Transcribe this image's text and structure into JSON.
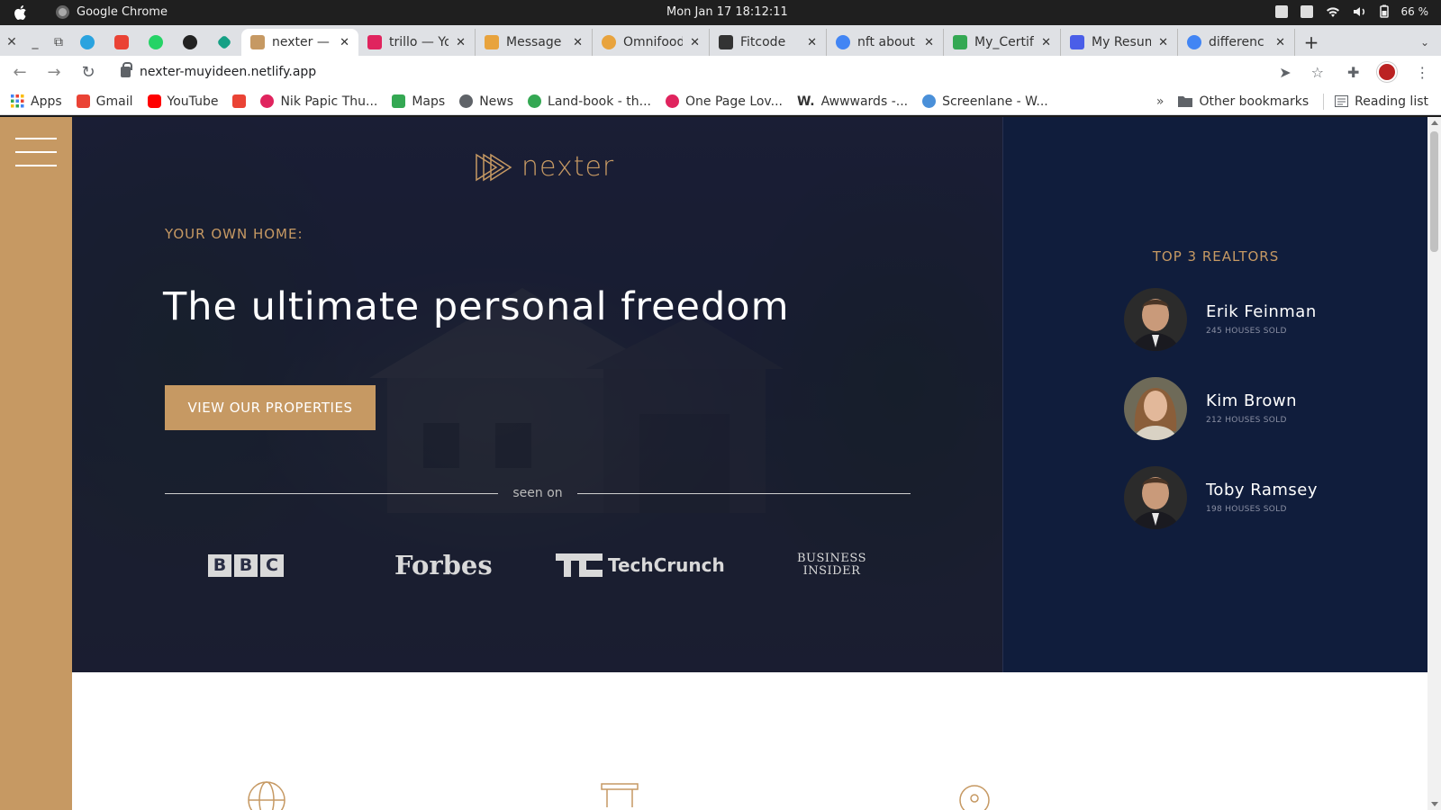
{
  "os": {
    "app_name": "Google Chrome",
    "clock": "Mon Jan 17  18:12:11",
    "battery": "66 %"
  },
  "tabs": [
    {
      "title": "nexter —",
      "active": true,
      "favicon_color": "#c69963"
    },
    {
      "title": "trillo — Yo",
      "active": false,
      "favicon_color": "#e0245e"
    },
    {
      "title": "Message",
      "active": false,
      "favicon_color": "#e8a33d"
    },
    {
      "title": "Omnifood",
      "active": false,
      "favicon_color": "#e8a33d"
    },
    {
      "title": "Fitcode",
      "active": false,
      "favicon_color": "#333333"
    },
    {
      "title": "nft about",
      "active": false,
      "favicon_color": "#4285f4"
    },
    {
      "title": "My_Certif",
      "active": false,
      "favicon_color": "#34a853"
    },
    {
      "title": "My Resum",
      "active": false,
      "favicon_color": "#4a5ee8"
    },
    {
      "title": "differenc",
      "active": false,
      "favicon_color": "#4285f4"
    }
  ],
  "pinned_icons": [
    "telegram-icon",
    "gmail-icon",
    "whatsapp-icon",
    "github-icon",
    "diamond-icon"
  ],
  "address": {
    "url": "nexter-muyideen.netlify.app"
  },
  "bookmarks": [
    {
      "label": "Apps",
      "color": "#4285f4"
    },
    {
      "label": "Gmail",
      "color": "#ea4335"
    },
    {
      "label": "YouTube",
      "color": "#ff0000"
    },
    {
      "label": "",
      "color": "#ea4335"
    },
    {
      "label": "Nik Papic Thu...",
      "color": "#e0245e"
    },
    {
      "label": "Maps",
      "color": "#34a853"
    },
    {
      "label": "News",
      "color": "#5f6368"
    },
    {
      "label": "Land-book - th...",
      "color": "#34a853"
    },
    {
      "label": "One Page Lov...",
      "color": "#e0245e"
    },
    {
      "label": "Awwwards -...",
      "color": "#111111"
    },
    {
      "label": "Screenlane - W...",
      "color": "#4a90d9"
    }
  ],
  "bookmarks_other": "Other bookmarks",
  "bookmarks_reading": "Reading list",
  "bookmarks_more": "»",
  "site": {
    "brand": "nexter",
    "kicker": "YOUR OWN HOME:",
    "headline": "The ultimate personal freedom",
    "cta": "VIEW OUR PROPERTIES",
    "seen_on": "seen on",
    "press": {
      "bbc": [
        "B",
        "B",
        "C"
      ],
      "forbes": "Forbes",
      "techcrunch": "TechCrunch",
      "business_insider_1": "BUSINESS",
      "business_insider_2": "INSIDER"
    },
    "realtors_title": "TOP 3 REALTORS",
    "realtors": [
      {
        "name": "Erik Feinman",
        "sold": "245 HOUSES SOLD"
      },
      {
        "name": "Kim Brown",
        "sold": "212 HOUSES SOLD"
      },
      {
        "name": "Toby Ramsey",
        "sold": "198 HOUSES SOLD"
      }
    ],
    "colors": {
      "gold": "#c69963",
      "navy": "#101d3c"
    }
  }
}
